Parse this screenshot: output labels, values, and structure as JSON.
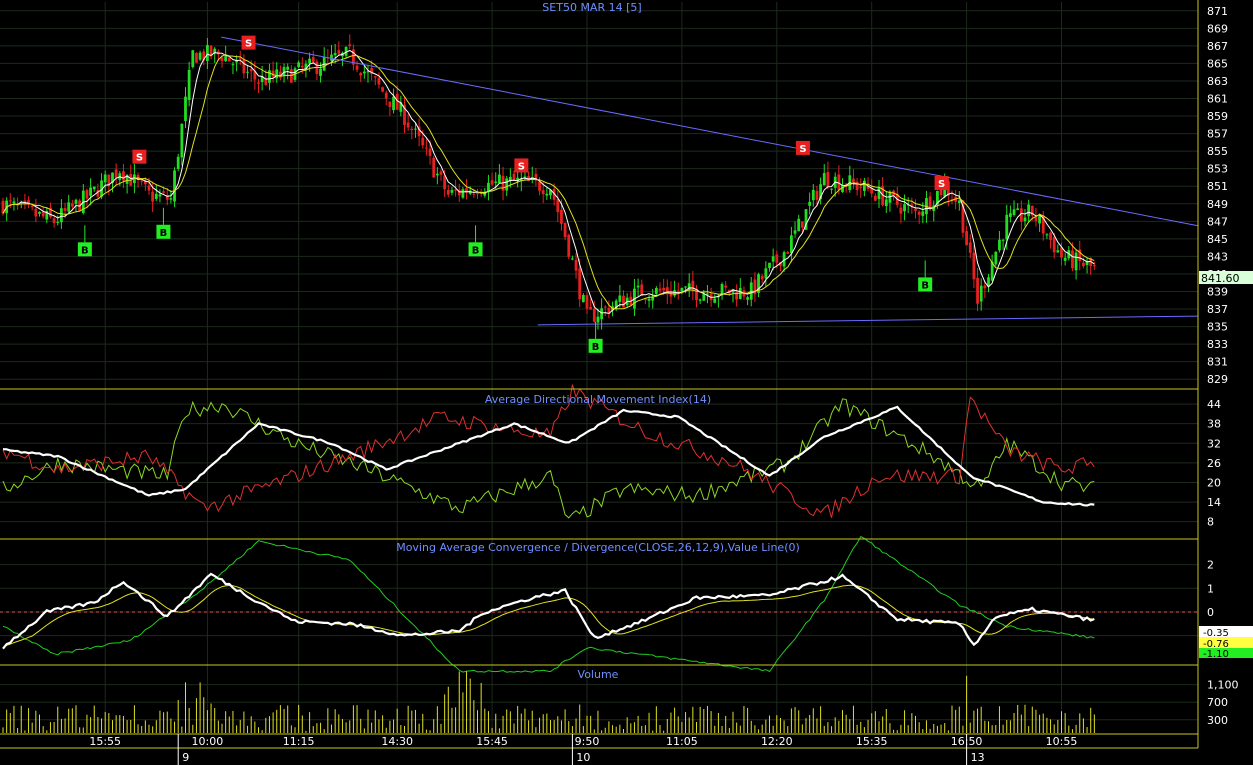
{
  "chart_data": [
    {
      "type": "candlestick",
      "title": "SET50 MAR 14   [5]",
      "y_ticks": [
        829,
        831,
        833,
        835,
        837,
        839,
        841,
        843,
        845,
        847,
        849,
        851,
        853,
        855,
        857,
        859,
        861,
        863,
        865,
        867,
        869,
        871
      ],
      "ylim": [
        828,
        872
      ],
      "last_price_label": "841.60",
      "last_price": 841.6,
      "signals": [
        {
          "label": "B",
          "type": "buy",
          "x": 0.075,
          "price": 847
        },
        {
          "label": "S",
          "type": "sell",
          "x": 0.125,
          "price": 853
        },
        {
          "label": "B",
          "type": "buy",
          "x": 0.147,
          "price": 849
        },
        {
          "label": "S",
          "type": "sell",
          "x": 0.225,
          "price": 866
        },
        {
          "label": "B",
          "type": "buy",
          "x": 0.433,
          "price": 847
        },
        {
          "label": "S",
          "type": "sell",
          "x": 0.475,
          "price": 852
        },
        {
          "label": "B",
          "type": "buy",
          "x": 0.543,
          "price": 836
        },
        {
          "label": "S",
          "type": "sell",
          "x": 0.733,
          "price": 854
        },
        {
          "label": "S",
          "type": "sell",
          "x": 0.86,
          "price": 850
        },
        {
          "label": "B",
          "type": "buy",
          "x": 0.845,
          "price": 843
        }
      ],
      "trend_lines": [
        {
          "x1": 0.2,
          "y1": 868,
          "x2": 1.0,
          "y2": 846.5
        },
        {
          "x1": 0.49,
          "y1": 835.2,
          "x2": 1.0,
          "y2": 836.2
        }
      ]
    },
    {
      "type": "line",
      "title": "Average Directional Movement Index(14)",
      "y_ticks": [
        8,
        14,
        20,
        26,
        32,
        38,
        44
      ],
      "ylim": [
        3,
        48
      ]
    },
    {
      "type": "line",
      "title": "Moving Average Convergence / Divergence(CLOSE,26,12,9),Value Line(0)",
      "y_ticks": [
        -1,
        0,
        1,
        2
      ],
      "ylim": [
        -2.2,
        3.0
      ],
      "value_labels": [
        "-0.35",
        "-0.76",
        "-1.10"
      ]
    },
    {
      "type": "bar",
      "title": "Volume",
      "y_ticks": [
        "300",
        "700",
        "1,100"
      ],
      "y_tick_values": [
        300,
        700,
        1100
      ],
      "ylim": [
        0,
        1500
      ]
    }
  ],
  "x_axis": {
    "time_labels": [
      "15:55",
      "10:00",
      "11:15",
      "14:30",
      "15:45",
      "9:50",
      "11:05",
      "12:20",
      "15:35",
      "16:50",
      "10:55"
    ],
    "day_labels": [
      "9",
      "10",
      "13"
    ]
  },
  "colors": {
    "background": "#000000",
    "grid": "#1c2a1c",
    "separator": "#c8c820",
    "title": "#6f8fff",
    "axis_text": "#ffffff",
    "up": "#22dd22",
    "down": "#e82020",
    "ma_fast": "#ffffff",
    "ma_slow": "#e0e020",
    "trend": "#6a6aff",
    "adx": "#ffffff",
    "plus_di": "#8ad820",
    "minus_di": "#e03030",
    "macd": "#ffffff",
    "macd_signal": "#e0e020",
    "macd_hist": "#22cc22",
    "zero": "#e05050",
    "volume": "#e0e020",
    "price_label_bg": "#d8ffd8",
    "buy": "#22ee22",
    "sell": "#e82020"
  }
}
